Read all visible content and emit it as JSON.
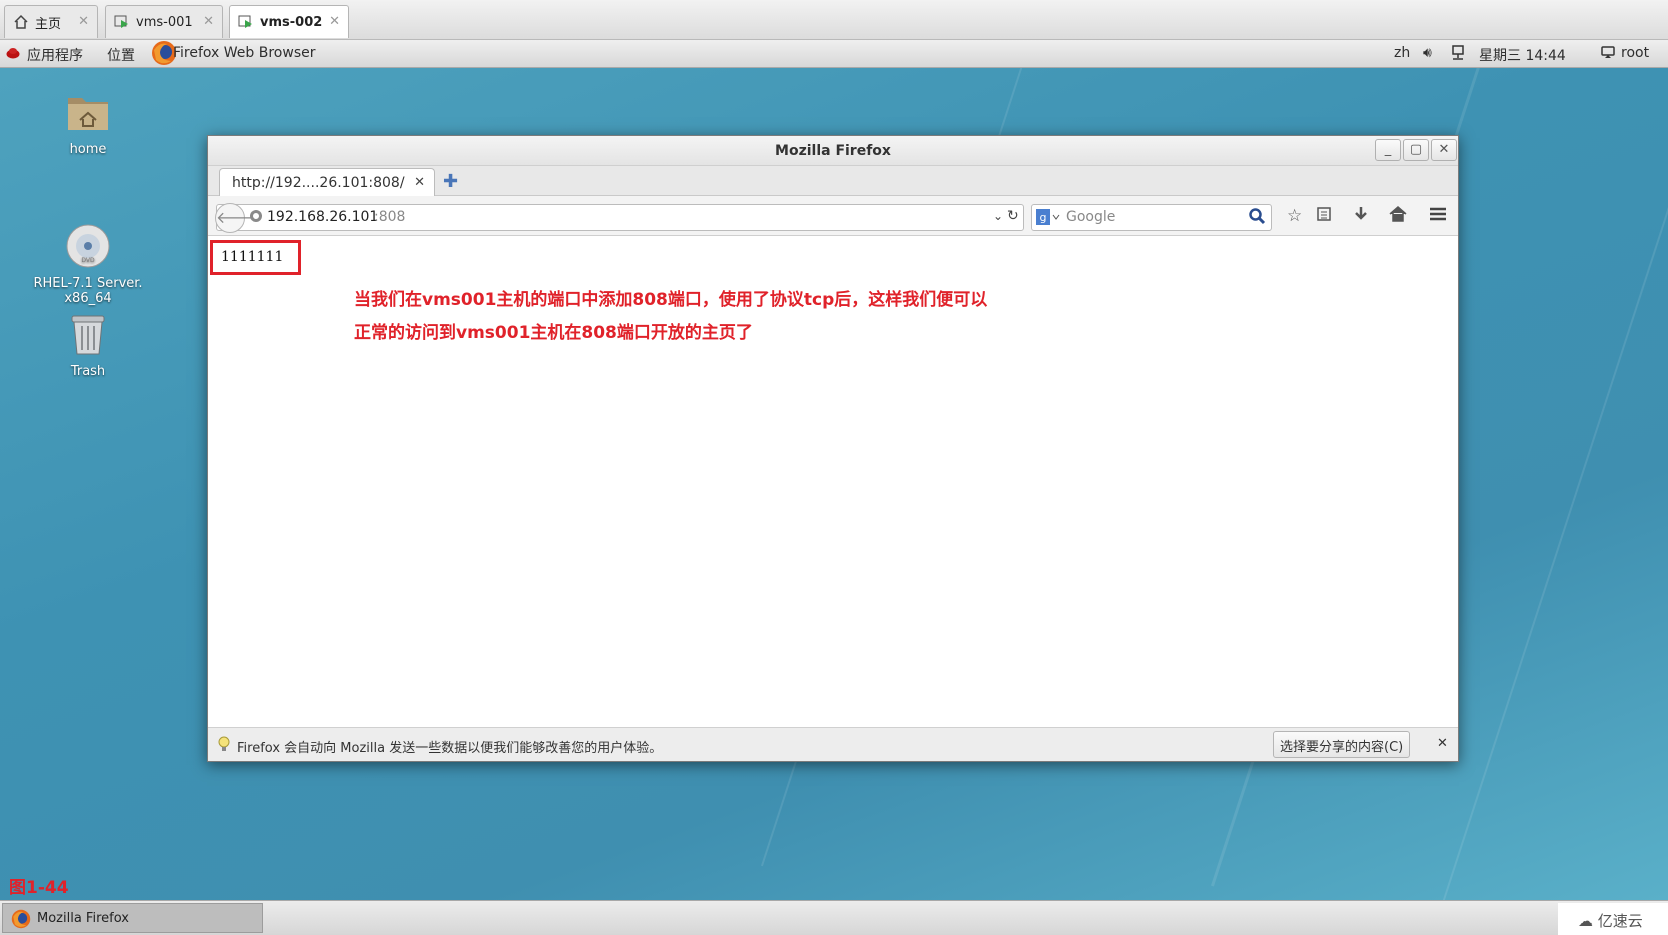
{
  "host_tabs": [
    {
      "label": "主页",
      "icon": "home-icon"
    },
    {
      "label": "vms-001",
      "icon": "vm-running-icon"
    },
    {
      "label": "vms-002",
      "icon": "vm-running-icon",
      "active": true
    }
  ],
  "topbar": {
    "applications": "应用程序",
    "places": "位置",
    "active_app": "Firefox Web Browser",
    "lang": "zh",
    "clock": "星期三 14:44",
    "user": "root"
  },
  "desktop": {
    "icons": [
      {
        "label": "home",
        "icon": "home-folder-icon"
      },
      {
        "label": "RHEL-7.1 Server.\nx86_64",
        "icon": "dvd-icon"
      },
      {
        "label": "Trash",
        "icon": "trash-icon"
      }
    ],
    "figure_label": "图1-44"
  },
  "firefox": {
    "window_title": "Mozilla Firefox",
    "tab_title": "http://192....26.101:808/",
    "url_host": "192.168.26.101",
    "url_port": ":808",
    "search_placeholder": "Google",
    "page_content": "1111111",
    "notification": "Firefox 会自动向 Mozilla 发送一些数据以便我们能够改善您的用户体验。",
    "notification_button": "选择要分享的内容(C)"
  },
  "annotation": {
    "line1": "当我们在vms001主机的端口中添加808端口，使用了协议tcp后，这样我们便可以",
    "line2": "正常的访问到vms001主机在808端口开放的主页了"
  },
  "taskbar": {
    "item": "Mozilla Firefox"
  },
  "watermark": "亿速云",
  "colors": {
    "accent_red": "#e0222a",
    "desktop_blue": "#3d8fae"
  }
}
